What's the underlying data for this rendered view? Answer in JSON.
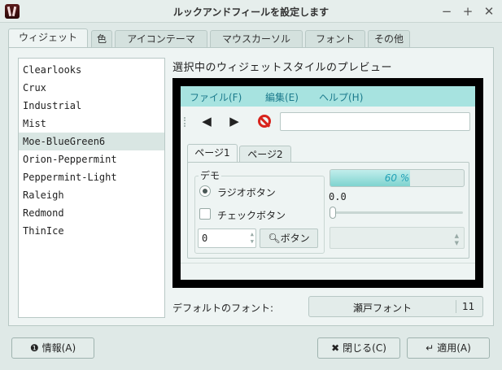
{
  "window": {
    "title": "ルックアンドフィールを設定します",
    "minimize": "−",
    "maximize": "+",
    "close": "✕"
  },
  "tabs": [
    {
      "label": "ウィジェット",
      "active": true
    },
    {
      "label": "色",
      "active": false
    },
    {
      "label": "アイコンテーマ",
      "active": false
    },
    {
      "label": "マウスカーソル",
      "active": false
    },
    {
      "label": "フォント",
      "active": false
    },
    {
      "label": "その他",
      "active": false
    }
  ],
  "themes": {
    "selected": "Moe-BlueGreen6",
    "items": [
      "Clearlooks",
      "Crux",
      "Industrial",
      "Mist",
      "Moe-BlueGreen6",
      "Orion-Peppermint",
      "Peppermint-Light",
      "Raleigh",
      "Redmond",
      "ThinIce"
    ]
  },
  "preview": {
    "heading": "選択中のウィジェットスタイルのプレビュー",
    "menu": [
      "ファイル(F)",
      "編集(E)",
      "ヘルプ(H)"
    ],
    "toolbar_icons": [
      "back-arrow-icon",
      "forward-arrow-icon",
      "stop-icon"
    ],
    "entry_value": "",
    "tabs": [
      "ページ1",
      "ページ2"
    ],
    "demo_title": "デモ",
    "radio_label": "ラジオボタン",
    "radio_checked": true,
    "check_label": "チェックボタン",
    "check_checked": false,
    "spin_value": "0",
    "search_button": "ボタン",
    "progress_text": "60 %",
    "progress_fraction": 0.6,
    "slider_value": "0.0",
    "accent_color": "#a7e3e0",
    "menu_text_color": "#1b7a8c"
  },
  "font": {
    "label": "デフォルトのフォント:",
    "name": "瀬戸フォント",
    "size": "11"
  },
  "buttons": {
    "info": "情報(A)",
    "close": "閉じる(C)",
    "apply": "適用(A)"
  }
}
